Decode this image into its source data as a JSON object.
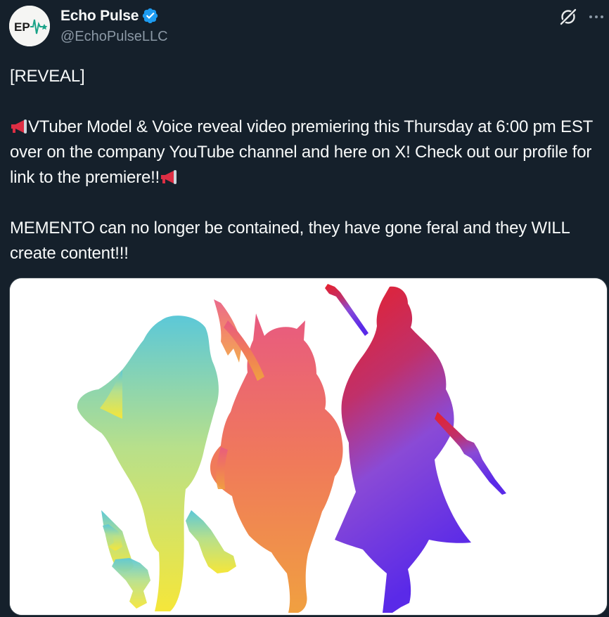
{
  "post": {
    "author": {
      "display_name": "Echo Pulse",
      "handle": "@EchoPulseLLC",
      "verified": true,
      "avatar_text": "EP",
      "avatar_colors": {
        "text": "#1a1a1a",
        "accent": "#1aa388",
        "background": "#f5f5f3"
      }
    },
    "actions": {
      "grok_icon": "grok-icon",
      "more_icon": "more-icon"
    },
    "text": {
      "line1": "[REVEAL]",
      "paragraph2_start": "VTuber Model & Voice reveal video premiering this Thursday at 6:00 pm EST over on the company YouTube channel and here on X! Check out our profile for link to the premiere!!",
      "paragraph3": "MEMENTO can no longer be contained, they have gone feral and they WILL create content!!!"
    },
    "icons": {
      "megaphone": "megaphone-emoji-icon",
      "verified": "verified-badge-icon"
    },
    "media": {
      "type": "image",
      "subject": "silhouettes",
      "colors": {
        "left_silhouette": [
          "#5cc8d8",
          "#b8e08a",
          "#f5e63a"
        ],
        "middle_silhouette": [
          "#e85a80",
          "#f08a5a",
          "#f0a040"
        ],
        "right_silhouette": [
          "#e8202a",
          "#9a4ad0",
          "#5a2ae8"
        ]
      }
    },
    "theme": {
      "background": "#15202b",
      "text_primary": "#f7f9f9",
      "text_secondary": "#8b98a5",
      "verified_blue": "#1d9bf0",
      "border": "#38444d"
    }
  }
}
